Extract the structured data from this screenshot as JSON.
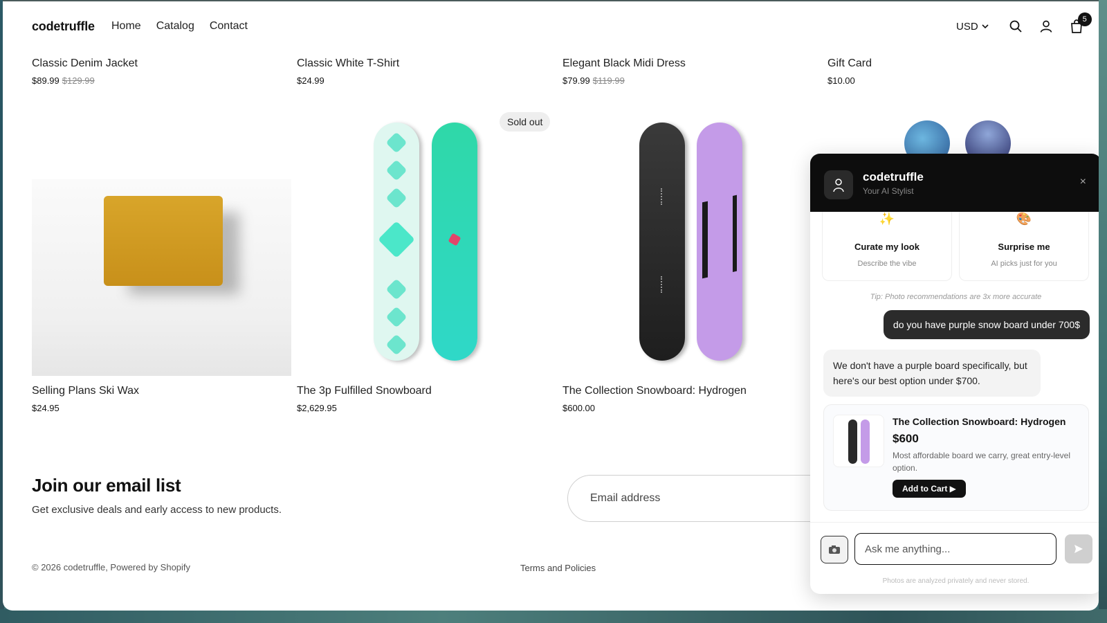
{
  "header": {
    "brand": "codetruffle",
    "nav": [
      "Home",
      "Catalog",
      "Contact"
    ],
    "currency": "USD",
    "cart_count": "5"
  },
  "products_top": [
    {
      "title": "Classic Denim Jacket",
      "price": "$89.99",
      "compare": "$129.99"
    },
    {
      "title": "Classic White T-Shirt",
      "price": "$24.99",
      "compare": ""
    },
    {
      "title": "Elegant Black Midi Dress",
      "price": "$79.99",
      "compare": "$119.99"
    },
    {
      "title": "Gift Card",
      "price": "$10.00",
      "compare": ""
    }
  ],
  "products_bottom": [
    {
      "title": "Selling Plans Ski Wax",
      "price": "$24.95"
    },
    {
      "title": "The 3p Fulfilled Snowboard",
      "price": "$2,629.95",
      "badge": "Sold out"
    },
    {
      "title": "The Collection Snowboard: Hydrogen",
      "price": "$600.00"
    }
  ],
  "newsletter": {
    "title": "Join our email list",
    "subtitle": "Get exclusive deals and early access to new products.",
    "email_placeholder": "Email address"
  },
  "footer": {
    "copyright": "© 2026 codetruffle, Powered by Shopify",
    "terms": "Terms and Policies"
  },
  "chat": {
    "name": "codetruffle",
    "subtitle": "Your AI Stylist",
    "close": "×",
    "quick_actions": [
      {
        "emoji": "✨",
        "title": "Curate my look",
        "desc": "Describe the vibe"
      },
      {
        "emoji": "🎨",
        "title": "Surprise me",
        "desc": "AI picks just for you"
      }
    ],
    "tip": "Tip: Photo recommendations are 3x more accurate",
    "user_message": "do you have purple snow board under 700$",
    "bot_message": "We don't have a purple board specifically, but here's our best option under $700.",
    "recommendation": {
      "name": "The Collection Snowboard: Hydrogen",
      "price": "$600",
      "desc": "Most affordable board we carry, great entry-level option.",
      "button": "Add to Cart ▶"
    },
    "input_placeholder": "Ask me anything...",
    "privacy": "Photos are analyzed privately and never stored."
  },
  "colors": {
    "accent": "#121212",
    "board_teal": "#2fd8c0",
    "board_purple": "#c49be8",
    "board_black": "#2a2a2a"
  }
}
